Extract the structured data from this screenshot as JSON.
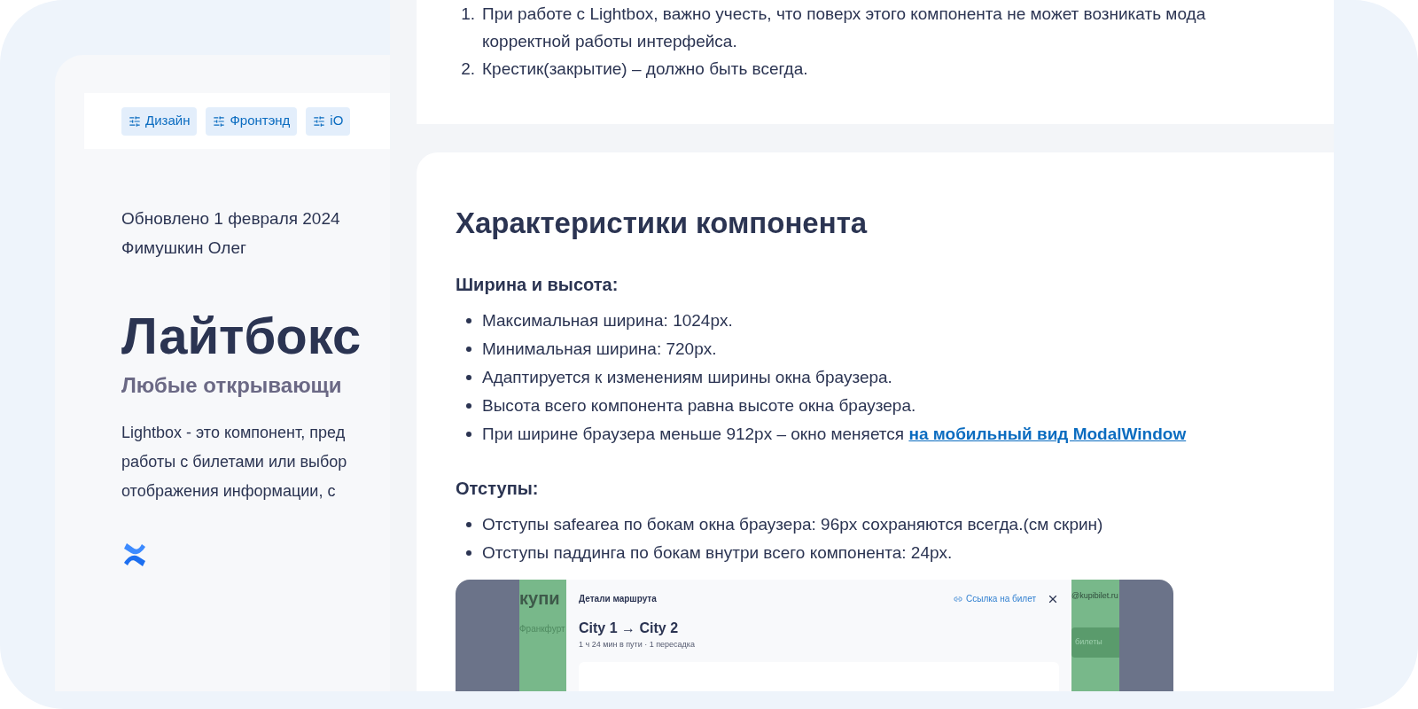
{
  "left_card": {
    "tags": [
      {
        "label": "Дизайн"
      },
      {
        "label": "Фронтэнд"
      },
      {
        "label": "iO"
      }
    ],
    "updated": "Обновлено 1 февраля 2024",
    "author": "Фимушкин Олег",
    "title": "Лайтбокс",
    "subtitle": "Любые открывающи",
    "description": [
      "Lightbox - это компонент, пред",
      "работы с билетами или выбор",
      "отображения информации, с"
    ]
  },
  "notes_card": {
    "items": [
      {
        "number": "1.",
        "lines": [
          "При работе с Lightbox, важно учесть, что поверх этого компонента не может возникать мода",
          "корректной работы интерфейса."
        ]
      },
      {
        "number": "2.",
        "lines": [
          "Крестик(закрытие) – должно быть всегда."
        ]
      }
    ]
  },
  "specs_card": {
    "title": "Характеристики компонента",
    "sections": [
      {
        "heading": "Ширина и высота:",
        "bullets": [
          {
            "text": "Максимальная ширина: 1024px."
          },
          {
            "text": "Минимальная ширина: 720px."
          },
          {
            "text": "Адаптируется к изменениям ширины окна браузера."
          },
          {
            "text": "Высота всего компонента равна высоте окна браузера."
          },
          {
            "text": "При ширине браузера меньше 912px – окно меняется",
            "link": "на мобильный вид ModalWindow"
          }
        ]
      },
      {
        "heading": "Отступы:",
        "bullets": [
          {
            "text": "Отступы safearea по бокам окна браузера: 96px сохраняются всегда.(см скрин)"
          },
          {
            "text": "Отступы паддинга по бокам внутри всего компонента: 24px."
          }
        ]
      }
    ],
    "screenshot": {
      "logo": "купи",
      "city": "Франкфурт",
      "email": "@kupibilet.ru",
      "button": "билеты",
      "modal": {
        "title": "Детали маршрута",
        "link": "Ссылка на билет",
        "route": "City 1 → City 2",
        "details": "1 ч 24 мин в пути · 1 пересадка"
      }
    }
  }
}
